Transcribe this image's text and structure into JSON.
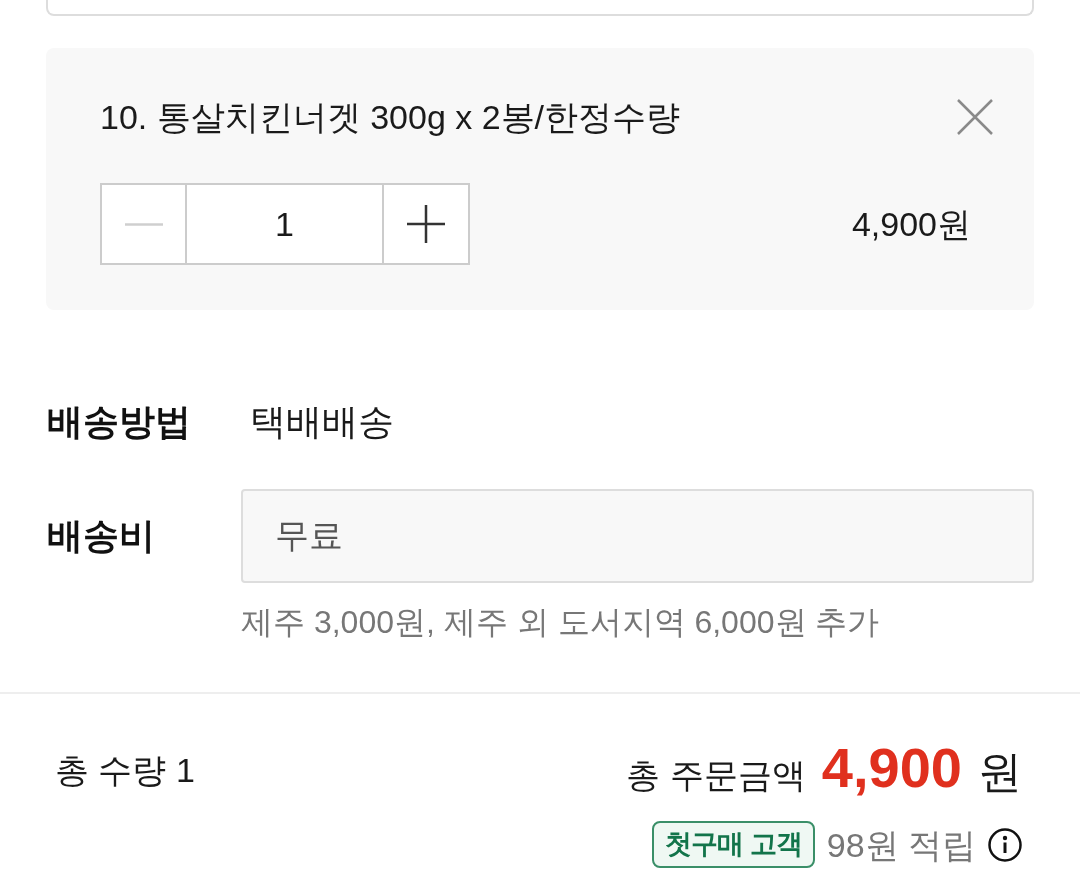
{
  "product": {
    "title": "10. 통살치킨너겟 300g x 2봉/한정수량",
    "decrease": {
      "disabled": true
    },
    "quantity": "1",
    "increase": {
      "disabled": false
    },
    "price": "4,900원"
  },
  "shipping": {
    "method_label": "배송방법",
    "method": "택배배송",
    "fee_label": "배송비",
    "fee_field": {
      "value": "무료",
      "disabled": true
    },
    "note": "제주 3,000원, 제주 외 도서지역 6,000원 추가"
  },
  "summary": {
    "quantity_text": "총 수량 1",
    "total_label": "총 주문금액",
    "total_amount": "4,900",
    "total_unit": "원",
    "badge": "첫구매 고객",
    "points": "98원 적립"
  }
}
